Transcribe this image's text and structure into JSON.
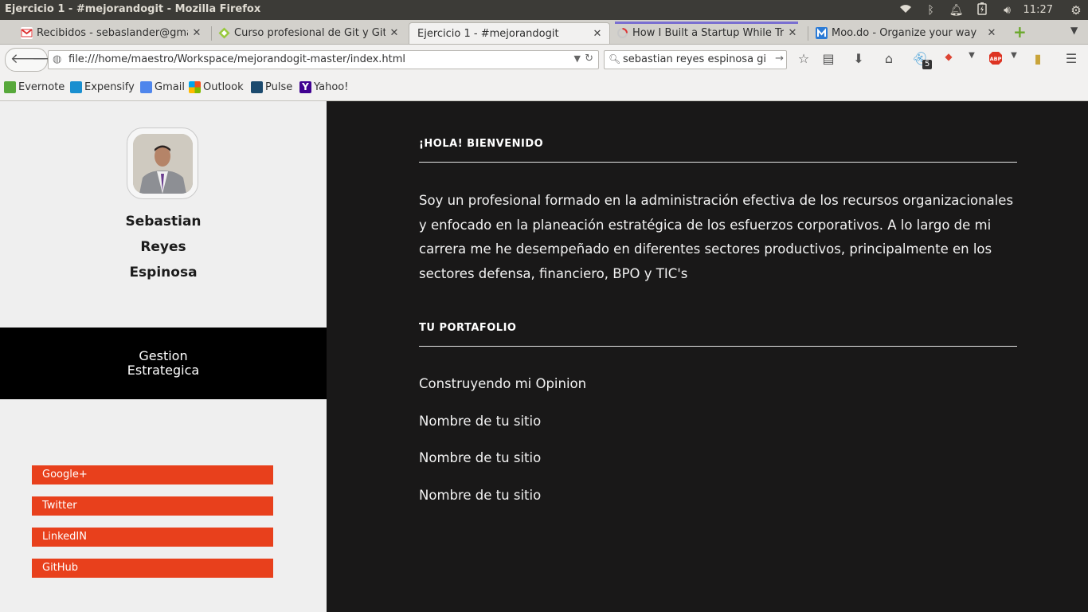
{
  "window": {
    "title": "Ejercicio 1 - #mejorandogit - Mozilla Firefox",
    "time": "11:27"
  },
  "tabs": [
    {
      "title": "Recibidos - sebaslander@gma...",
      "icon": "gmail-icon"
    },
    {
      "title": "Curso profesional de Git y Git...",
      "icon": "platzi-icon"
    },
    {
      "title": "Ejercicio 1 - #mejorandogit",
      "icon": "none"
    },
    {
      "title": "How I Built a Startup While Tr...",
      "icon": "loading-icon"
    },
    {
      "title": "Moo.do - Organize your way",
      "icon": "moodo-icon"
    }
  ],
  "toolbar": {
    "url": "file:///home/maestro/Workspace/mejorandogit-master/index.html",
    "search": "sebastian reyes espinosa github",
    "ghostery_count": "5"
  },
  "bookmarks": [
    "Evernote",
    "Expensify",
    "Gmail",
    "Outlook",
    "Pulse",
    "Yahoo!"
  ],
  "profile": {
    "name_lines": [
      "Sebastian",
      "Reyes",
      "Espinosa"
    ],
    "role_lines": [
      "Gestion",
      "Estrategica"
    ]
  },
  "social_links": [
    "Google+",
    "Twitter",
    "LinkedIN",
    "GitHub"
  ],
  "content": {
    "welcome_title": "¡HOLA! BIENVENIDO",
    "bio": "Soy un profesional formado en la administración efectiva de los recursos organizacionales y enfocado en la planeación estratégica de los esfuerzos corporativos. A lo largo de mi carrera me he desempeñado en diferentes sectores productivos, principalmente en los sectores defensa, financiero, BPO y TIC's",
    "portfolio_title": "TU PORTAFOLIO",
    "portfolio_items": [
      "Construyendo mi Opinion",
      "Nombre de tu sitio",
      "Nombre de tu sitio",
      "Nombre de tu sitio"
    ]
  },
  "colors": {
    "accent": "#e8401c",
    "main_bg": "#191818",
    "sidebar_bg": "#efefef",
    "role_band": "#000000"
  }
}
